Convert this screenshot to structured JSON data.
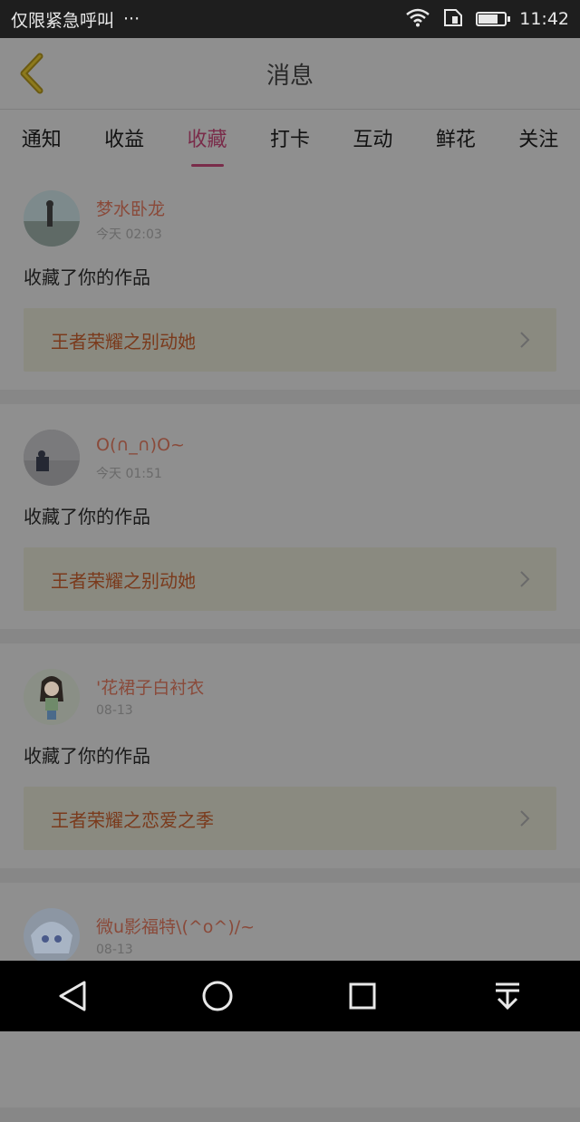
{
  "status_bar": {
    "carrier": "仅限紧急呼叫",
    "more": "···",
    "time": "11:42",
    "battery_level": 0.75
  },
  "header": {
    "title": "消息"
  },
  "tabs": [
    {
      "label": "通知",
      "active": false
    },
    {
      "label": "收益",
      "active": false
    },
    {
      "label": "收藏",
      "active": true
    },
    {
      "label": "打卡",
      "active": false
    },
    {
      "label": "互动",
      "active": false
    },
    {
      "label": "鲜花",
      "active": false
    },
    {
      "label": "关注",
      "active": false
    }
  ],
  "messages": [
    {
      "username": "梦水卧龙",
      "time": "今天 02:03",
      "action": "收藏了你的作品",
      "work": "王者荣耀之别动她"
    },
    {
      "username": "O(∩_∩)O~",
      "time": "今天 01:51",
      "action": "收藏了你的作品",
      "work": "王者荣耀之别动她"
    },
    {
      "username": "'花裙子白衬衣",
      "time": "08-13",
      "action": "收藏了你的作品",
      "work": "王者荣耀之恋爱之季"
    },
    {
      "username": "微u影福特\\(^o^)/~",
      "time": "08-13",
      "action": "",
      "work": ""
    }
  ]
}
